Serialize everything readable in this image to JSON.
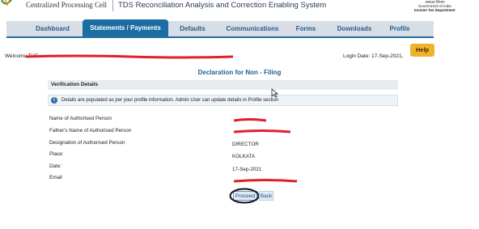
{
  "header": {
    "org_name": "Centralized Processing Cell",
    "system_title": "TDS Reconciliation Analysis and Correction Enabling System",
    "gov_hindi": "आयकर विभाग",
    "gov_line1": "Government of India",
    "gov_line2": "Income Tax Department"
  },
  "nav": {
    "items": [
      "Dashboard",
      "Statements / Payments",
      "Defaults",
      "Communications",
      "Forms",
      "Downloads",
      "Profile"
    ],
    "active": "Statements / Payments"
  },
  "help_label": "Help",
  "welcome_prefix": "Welcome THE",
  "login_date": "Login Date: 17-Sep-2021,",
  "page_title": "Declaration for Non - Filing",
  "verification": {
    "header": "Verification Details",
    "info": "Details are populated as per your profile information. Admin User can update details in Profile section"
  },
  "fields": {
    "auth_person_label": "Name of Authorised Person",
    "father_label": "Father's Name of Authorised Person",
    "designation_label": "Designation of Authorised Person",
    "designation_value": "DIRECTOR",
    "place_label": "Place:",
    "place_value": "KOLKATA",
    "date_label": "Date:",
    "date_value": "17-Sep-2021",
    "email_label": "Email"
  },
  "buttons": {
    "proceed": "Proceed",
    "back": "Back"
  },
  "colors": {
    "nav_active": "#1b6da3",
    "help": "#f0b22b",
    "title": "#1f5f90",
    "redaction": "#e0202a"
  }
}
